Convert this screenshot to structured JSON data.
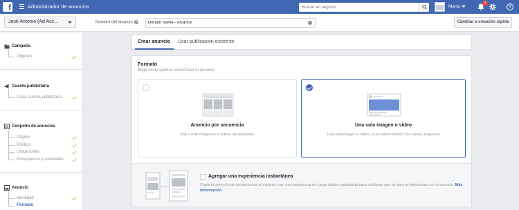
{
  "topbar": {
    "logo": "f",
    "title": "Administrador de anuncios",
    "search_placeholder": "Buscar en negocio",
    "user_name": "Marta",
    "notification_count": "2"
  },
  "subbar": {
    "account": "José Antonio (Ad Acc...",
    "ad_name_label": "Nombre del anuncio",
    "ad_name_value": "Default Name - Alcance",
    "quick_create_label": "Cambiar a creación rápida"
  },
  "sidebar": {
    "campaign": {
      "label": "Campaña",
      "items": [
        {
          "label": "Objetivo",
          "done": true
        }
      ]
    },
    "account": {
      "label": "Cuenta publicitaria",
      "items": [
        {
          "label": "Crear cuenta publicitaria",
          "done": true
        }
      ]
    },
    "adset": {
      "label": "Conjunto de anuncios",
      "items": [
        {
          "label": "Página",
          "done": true
        },
        {
          "label": "Público",
          "done": true
        },
        {
          "label": "Ubicaciones",
          "done": true
        },
        {
          "label": "Presupuesto y calendario",
          "done": true
        }
      ]
    },
    "ad": {
      "label": "Anuncio",
      "items": [
        {
          "label": "Identidad",
          "done": true
        },
        {
          "label": "Formato",
          "active": true
        }
      ]
    }
  },
  "tabs": [
    {
      "label": "Crear anuncio",
      "active": true
    },
    {
      "label": "Usar publicación existente",
      "active": false
    }
  ],
  "format": {
    "title": "Formato",
    "subtitle": "Elige cómo quieres estructurar tu anuncio.",
    "options": [
      {
        "title": "Anuncio por secuencia",
        "description": "Dos o más imágenes o vídeos desplazables",
        "selected": false
      },
      {
        "title": "Una sola imagen o vídeo",
        "description": "Una sola imagen o vídeo, o una presentación con varias imágenes",
        "selected": true
      }
    ],
    "instant": {
      "title": "Agregar una experiencia instantánea",
      "description": "Capta la atención de las personas al instante con una experiencia de carga rápida optimizada para celulares que se abre al interactuar con tu anuncio.",
      "link": "Más información"
    }
  },
  "colors": {
    "brand": "#4267b2",
    "badge": "#fa3e3e",
    "check": "#b3d06d"
  }
}
